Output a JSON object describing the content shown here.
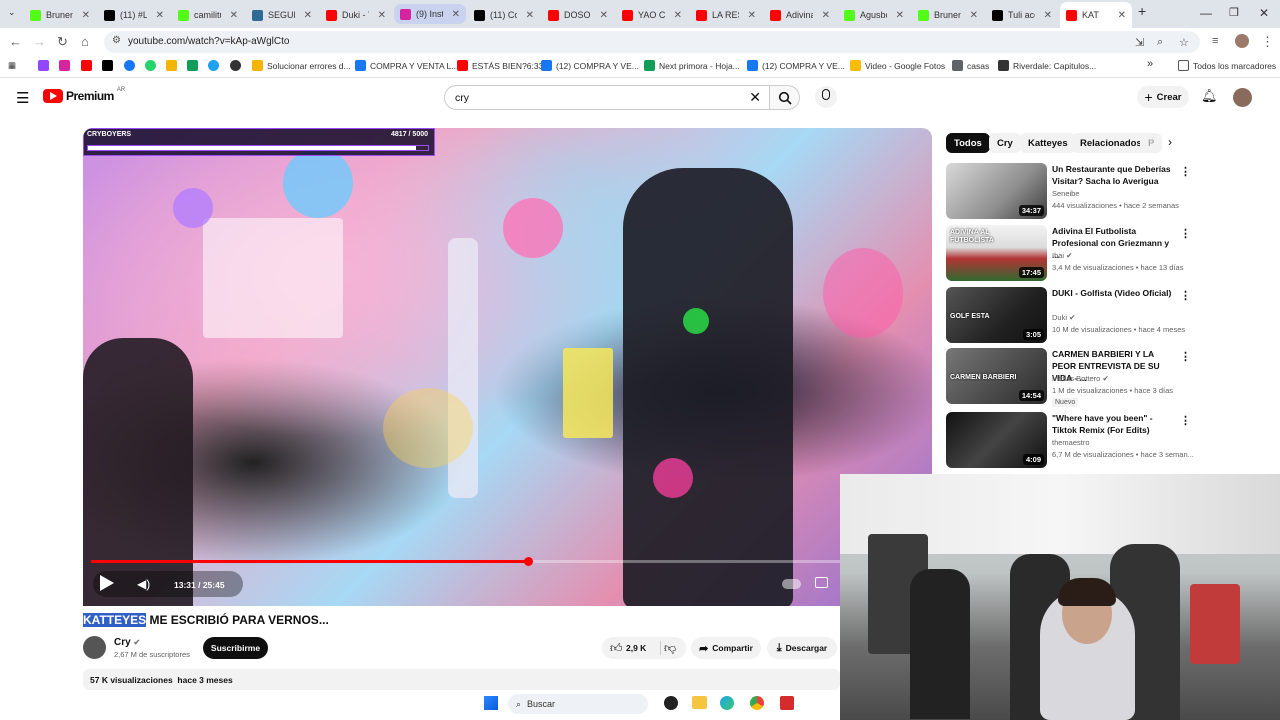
{
  "browser": {
    "tabs": [
      {
        "title": "Brunen",
        "icon": "kick-icon",
        "color": "#53fc18"
      },
      {
        "title": "(11) #L",
        "icon": "x-icon",
        "color": "#000000"
      },
      {
        "title": "camilitu",
        "icon": "kick-icon",
        "color": "#53fc18"
      },
      {
        "title": "SEGUN",
        "icon": "site-icon",
        "color": "#2f6a94"
      },
      {
        "title": "Duki - Y",
        "icon": "youtube-icon",
        "color": "#ff0000"
      },
      {
        "title": "(9) Insta",
        "icon": "instagram-icon",
        "color": "#d6249f"
      },
      {
        "title": "(11) Co",
        "icon": "x-icon",
        "color": "#000000"
      },
      {
        "title": "DOSOC",
        "icon": "youtube-icon",
        "color": "#ff0000"
      },
      {
        "title": "YAO CA",
        "icon": "youtube-icon",
        "color": "#ff0000"
      },
      {
        "title": "LA RESI",
        "icon": "youtube-icon",
        "color": "#ff0000"
      },
      {
        "title": "Adivina",
        "icon": "youtube-icon",
        "color": "#ff0000"
      },
      {
        "title": "Agusbo",
        "icon": "kick-icon",
        "color": "#53fc18"
      },
      {
        "title": "Brunen",
        "icon": "kick-icon",
        "color": "#53fc18"
      },
      {
        "title": "Tuli acc",
        "icon": "tiktok-icon",
        "color": "#000000"
      },
      {
        "title": "KAT",
        "icon": "youtube-icon",
        "color": "#ff0000"
      }
    ],
    "url": "youtube.com/watch?v=kAp-aWglCto",
    "bookmarks": [
      {
        "label": "Solucionar errores d...",
        "color": "#f4b400"
      },
      {
        "label": "COMPRA Y VENTA L...",
        "color": "#1877f2"
      },
      {
        "label": "ESTÁS BIEN?6:33",
        "color": "#ff0000"
      },
      {
        "label": "(12) COMPRA Y VE...",
        "color": "#1877f2"
      },
      {
        "label": "Next primora - Hoja...",
        "color": "#0f9d58"
      },
      {
        "label": "(12) COMPRA Y VE...",
        "color": "#1877f2"
      },
      {
        "label": "Video - Google Fotos",
        "color": "#fbbc04"
      },
      {
        "label": "casas",
        "color": "#5f6368"
      },
      {
        "label": "Riverdale: Capitulos...",
        "color": "#333333"
      }
    ],
    "all_bookmarks": "Todos los marcadores"
  },
  "youtube": {
    "logo": "Premium",
    "region": "AR",
    "search_query": "cry",
    "create_label": "Crear",
    "player": {
      "overlay_name": "CRYBOYERS",
      "overlay_count": "4817 / 5000",
      "overlay_progress": 0.9634,
      "time": "13:31 / 25:45",
      "progress": 0.525
    },
    "video_title_highlight": "KATTEYES",
    "video_title_rest": " ME ESCRIBIÓ PARA VERNOS...",
    "channel": "Cry",
    "subscribers": "2,67 M de suscriptores",
    "subscribe_label": "Suscribirme",
    "likes": "2,9 K",
    "share_label": "Compartir",
    "download_label": "Descargar",
    "views": "57 K visualizaciones",
    "age": "hace 3 meses",
    "chips": [
      "Todos",
      "Cry",
      "Katteyes",
      "Relacionados",
      "P"
    ],
    "recommendations": [
      {
        "title": "Un Restaurante que Deberías Visitar? Sacha lo Averigua",
        "channel": "Seneibe",
        "stats": "444 visualizaciones • hace 2 semanas",
        "duration": "34:37",
        "verified": false,
        "new": false
      },
      {
        "title": "Adivina El Futbolista Profesional con Griezmann y ...",
        "channel": "Ibai",
        "stats": "3,4 M de visualizaciones • hace 13 días",
        "duration": "17:45",
        "verified": true,
        "new": false
      },
      {
        "title": "DUKI - Golfista (Video Oficial)",
        "channel": "Duki",
        "stats": "10 M de visualizaciones • hace 4 meses",
        "duration": "3:05",
        "verified": true,
        "new": false
      },
      {
        "title": "CARMEN BARBIERI Y LA PEOR ENTREVISTA DE SU VIDA - ...",
        "channel": "Matias Bottero",
        "stats": "1 M de visualizaciones • hace 3 días",
        "duration": "14:54",
        "verified": true,
        "new": true,
        "new_label": "Nuevo"
      },
      {
        "title": "\"Where have you been\" - Tiktok Remix (For Edits)",
        "channel": "themaestro",
        "stats": "6,7 M de visualizaciones • hace 3 seman...",
        "duration": "4:09",
        "verified": false,
        "new": false
      }
    ],
    "thumb_texts": [
      "ADIVINA AL FUTBOLISTA",
      "GOLF ESTA",
      "CARMEN BARBIERI"
    ]
  },
  "taskbar": {
    "search_label": "Buscar"
  }
}
